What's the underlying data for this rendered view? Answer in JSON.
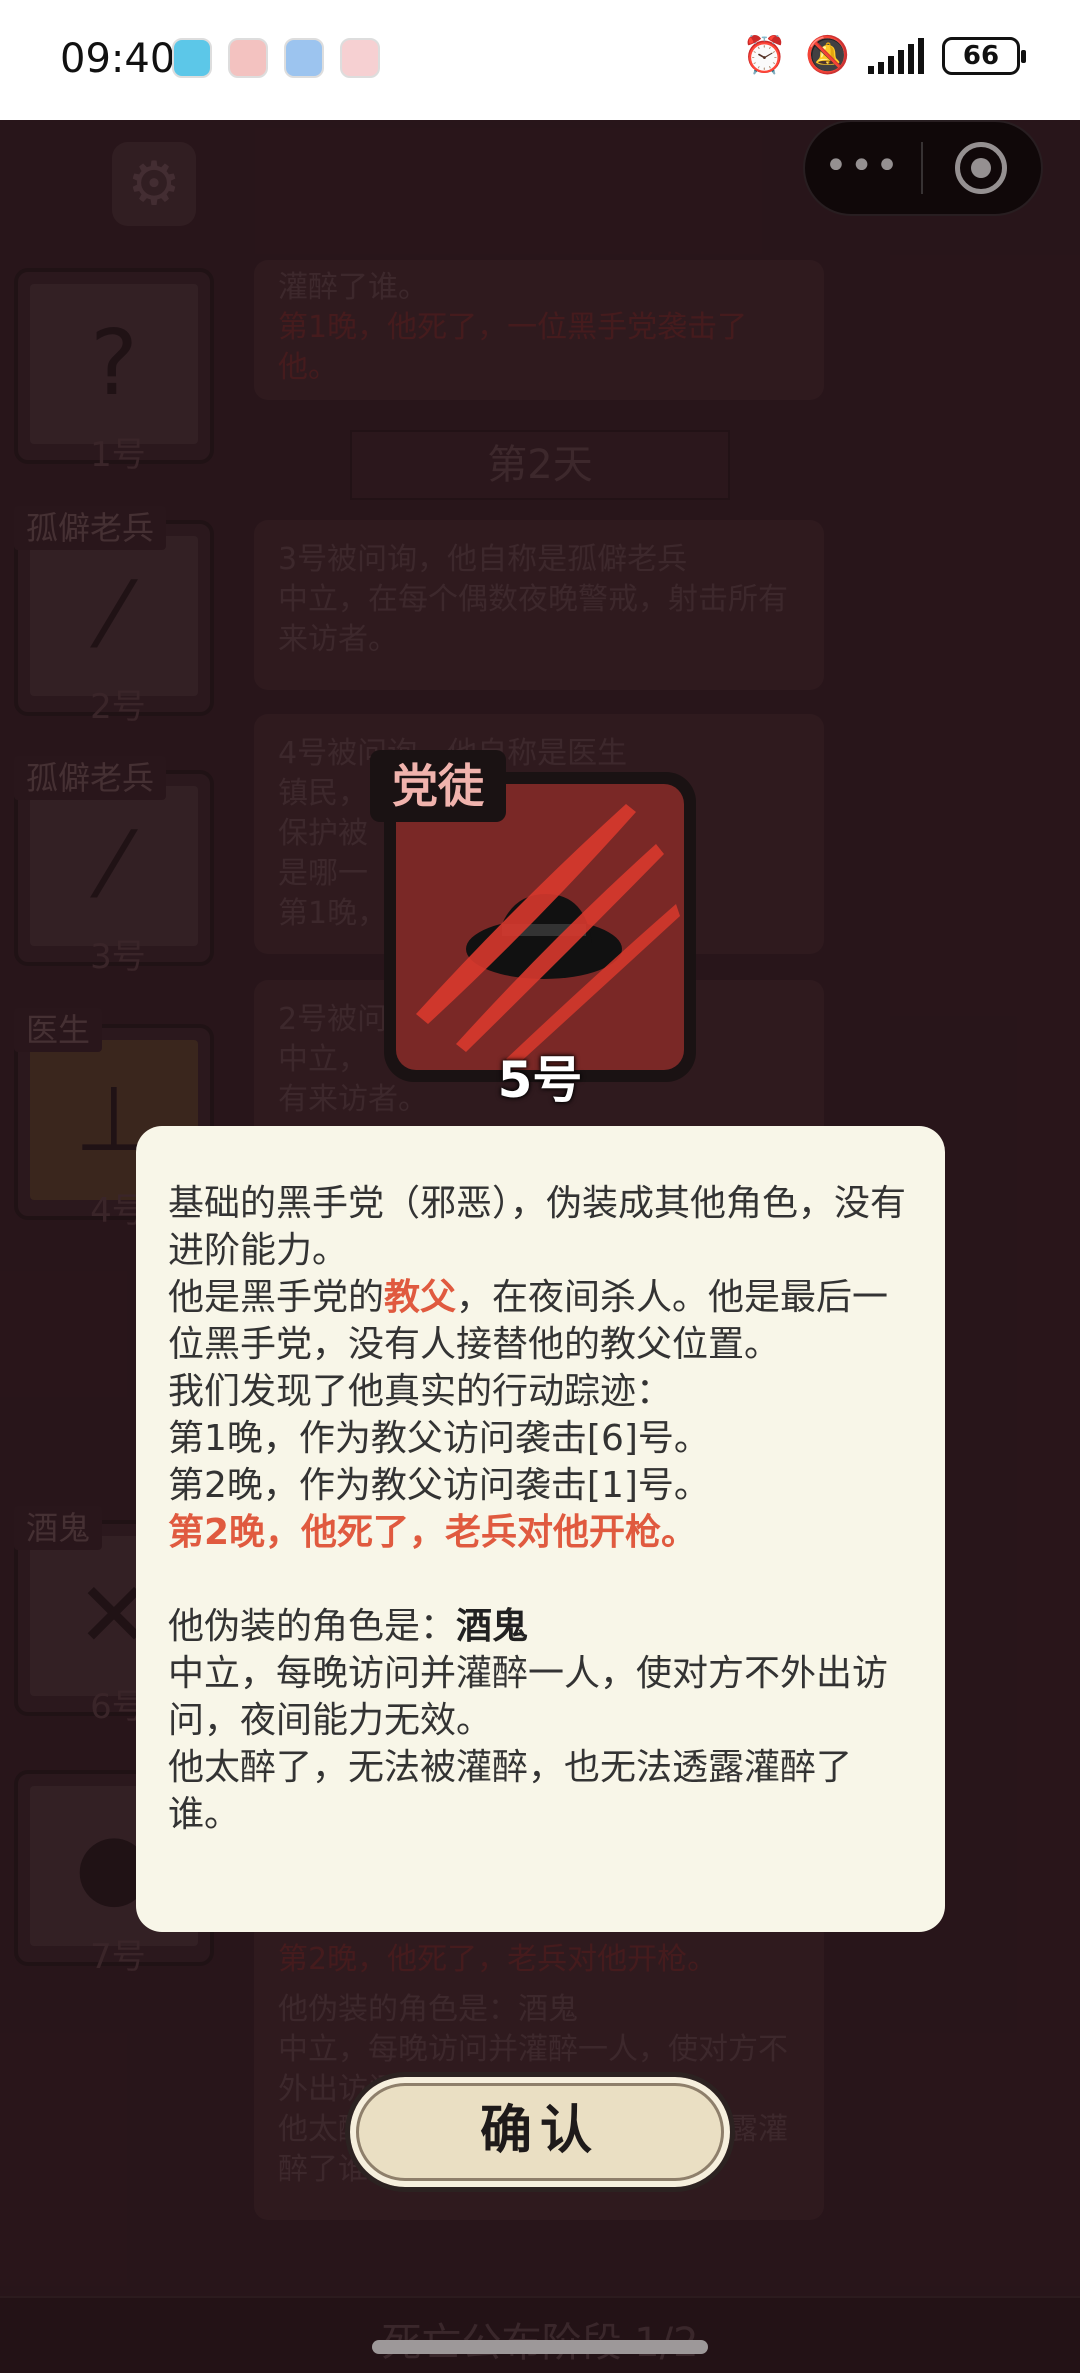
{
  "status_bar": {
    "time": "09:40",
    "battery": "66",
    "icons": [
      "alarm-icon",
      "mute-icon",
      "signal-icon",
      "battery-icon"
    ]
  },
  "game": {
    "settings_icon": "gear-icon",
    "capsule": {
      "more": "•••",
      "close_icon": "target-icon"
    },
    "players": [
      {
        "num": "1号",
        "role": ""
      },
      {
        "num": "2号",
        "role": "孤僻老兵"
      },
      {
        "num": "3号",
        "role": "孤僻老兵"
      },
      {
        "num": "4号",
        "role": "医生"
      },
      {
        "num": "6号",
        "role": "酒鬼"
      },
      {
        "num": "7号",
        "role": ""
      }
    ],
    "logs": {
      "top_line": "灌醉了谁。",
      "top_red": "第1晚，他死了，一位黑手党袭击了他。",
      "day2": "第2天",
      "log2": "3号被问询，他自称是孤僻老兵\n中立，在每个偶数夜晚警戒，射击所有来访者。",
      "log3": "4号被问询，他自称是医生\n镇民，\n保护被\n是哪一\n第1晚，",
      "log4": "2号被问询\n中立，\n有来访者。",
      "log5_red": "第2晚，他死了，老兵对他开枪。",
      "log5": "他伪装的角色是：酒鬼\n中立，每晚访问并灌醉一人，使对方不外出访问，夜间能力无效。\n他太醉了，无法被灌醉，也无法透露灌醉了谁。"
    },
    "bottom_bar": "死亡公布阶段 1/2"
  },
  "reveal": {
    "role_name": "党徒",
    "player_num": "5号",
    "card_colors": {
      "bg": "#7a2826",
      "claw": "#d8382d"
    }
  },
  "dialog": {
    "line1": "基础的黑手党（邪恶），伪装成其他角色，没有进阶能力。",
    "line2_pre": "他是黑手党的",
    "line2_hl": "教父",
    "line2_post": "，在夜间杀人。他是最后一位黑手党，没有人接替他的教父位置。",
    "line3": "我们发现了他真实的行动踪迹：",
    "line4": "第1晚，作为教父访问袭击[6]号。",
    "line5": "第2晚，作为教父访问袭击[1]号。",
    "line6": "第2晚，他死了，老兵对他开枪。",
    "line7_pre": "他伪装的角色是：",
    "line7_role": "酒鬼",
    "line8": "中立，每晚访问并灌醉一人，使对方不外出访问，夜间能力无效。",
    "line9": "他太醉了，无法被灌醉，也无法透露灌醉了谁。"
  },
  "confirm_label": "确认"
}
